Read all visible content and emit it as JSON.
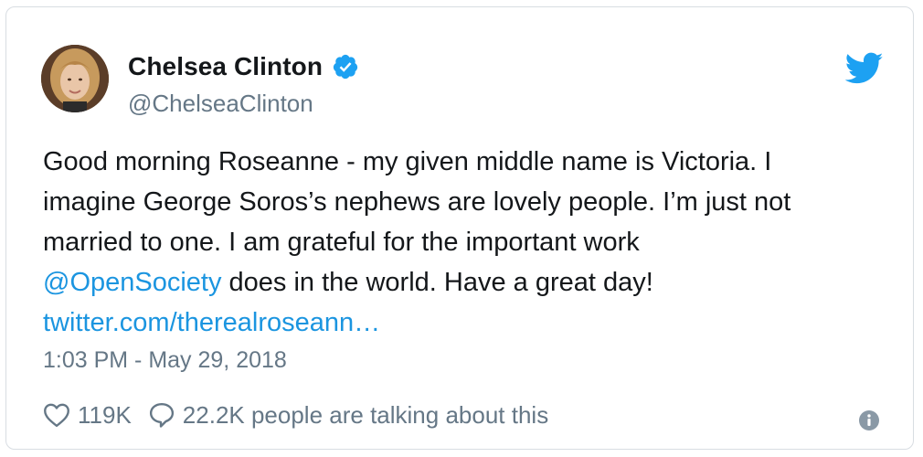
{
  "tweet": {
    "author": {
      "name": "Chelsea Clinton",
      "handle": "@ChelseaClinton",
      "verified": true
    },
    "text": {
      "line1": "Good morning Roseanne - my given middle name is Victoria. I",
      "line2": "imagine George Soros’s nephews are lovely people. I’m just not",
      "line3": "married to one. I am grateful for the important work",
      "mention": "@OpenSociety",
      "line4_rest": " does in the world. Have a great day!",
      "link": "twitter.com/therealroseann…"
    },
    "timestamp": "1:03 PM - May 29, 2018",
    "likes": "119K",
    "talking": "22.2K people are talking about this"
  },
  "icons": {
    "brand": "twitter-bird-icon",
    "verified": "verified-badge-icon",
    "like": "heart-icon",
    "reply": "speech-bubble-icon",
    "info": "info-icon"
  },
  "colors": {
    "link": "#1b95e0",
    "brand": "#1da1f2",
    "muted": "#657786",
    "text": "#14171a",
    "border": "#d8dde2"
  }
}
